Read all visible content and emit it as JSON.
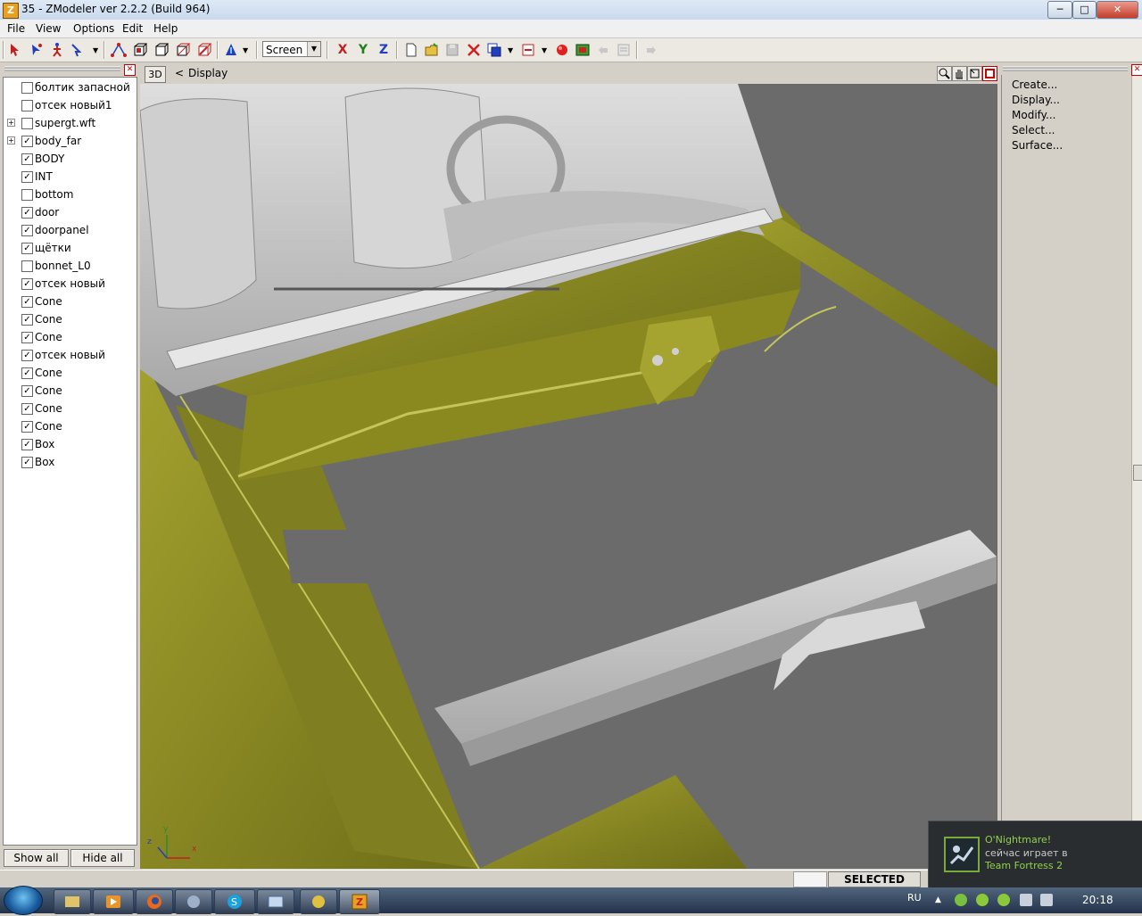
{
  "window": {
    "app_icon_letter": "Z",
    "title": "35 - ZModeler ver 2.2.2 (Build 964)",
    "controls": {
      "minimize": "─",
      "maximize": "□",
      "close": "✕"
    }
  },
  "menu": {
    "file": "File",
    "view": "View",
    "options": "Options",
    "edit": "Edit",
    "help": "Help"
  },
  "toolbar": {
    "view_select": "Screen",
    "axis_x": "X",
    "axis_y": "Y",
    "axis_z": "Z"
  },
  "object_tree": {
    "items": [
      {
        "label": "болтик запасной",
        "checked": false,
        "expandable": false
      },
      {
        "label": "отсек новый1",
        "checked": false,
        "expandable": false
      },
      {
        "label": "supergt.wft",
        "checked": false,
        "expandable": true
      },
      {
        "label": "body_far",
        "checked": true,
        "expandable": true
      },
      {
        "label": "BODY",
        "checked": true,
        "expandable": false
      },
      {
        "label": "INT",
        "checked": true,
        "expandable": false
      },
      {
        "label": "bottom",
        "checked": false,
        "expandable": false
      },
      {
        "label": "door",
        "checked": true,
        "expandable": false
      },
      {
        "label": "doorpanel",
        "checked": true,
        "expandable": false
      },
      {
        "label": "щётки",
        "checked": true,
        "expandable": false
      },
      {
        "label": "bonnet_L0",
        "checked": false,
        "expandable": false
      },
      {
        "label": "отсек новый",
        "checked": true,
        "expandable": false
      },
      {
        "label": "Cone",
        "checked": true,
        "expandable": false
      },
      {
        "label": "Cone",
        "checked": true,
        "expandable": false
      },
      {
        "label": "Cone",
        "checked": true,
        "expandable": false
      },
      {
        "label": "отсек новый",
        "checked": true,
        "expandable": false
      },
      {
        "label": "Cone",
        "checked": true,
        "expandable": false
      },
      {
        "label": "Cone",
        "checked": true,
        "expandable": false
      },
      {
        "label": "Cone",
        "checked": true,
        "expandable": false
      },
      {
        "label": "Cone",
        "checked": true,
        "expandable": false
      },
      {
        "label": "Box",
        "checked": true,
        "expandable": false
      },
      {
        "label": "Box",
        "checked": true,
        "expandable": false
      }
    ],
    "show_all": "Show all",
    "hide_all": "Hide all"
  },
  "viewport": {
    "mode_badge": "3D",
    "back_arrow": "<",
    "label": "Display",
    "axis_z": "z",
    "axis_y": "y",
    "axis_x": "x",
    "model_color": "#8b8a22",
    "interior_color": "#c9c9c9",
    "background_color": "#6b6b6b"
  },
  "commands": {
    "items": [
      "Create...",
      "Display...",
      "Modify...",
      "Select...",
      "Surface..."
    ]
  },
  "status": {
    "mode": "SELECTED MODE"
  },
  "notification": {
    "user": "O'Nightmare!",
    "line2": "сейчас играет в",
    "game": "Team Fortress 2"
  },
  "taskbar": {
    "lang": "RU",
    "clock": "20:18"
  }
}
